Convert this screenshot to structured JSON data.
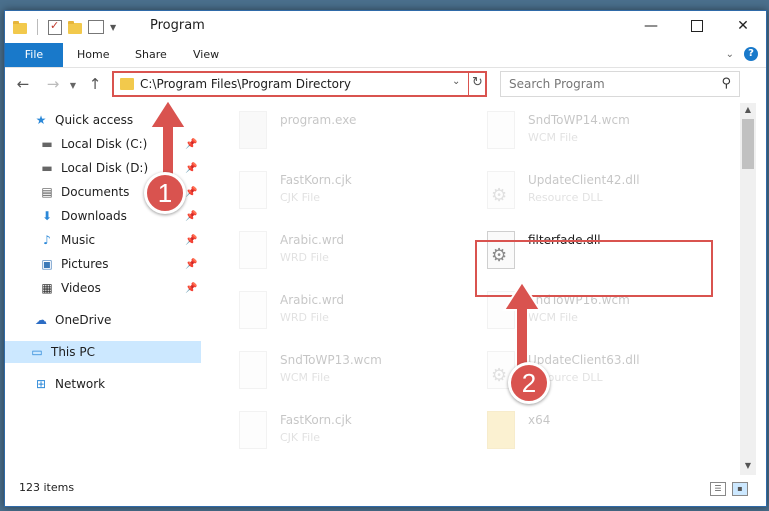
{
  "window": {
    "title": "Program"
  },
  "ribbon": {
    "tabs": [
      "File",
      "Home",
      "Share",
      "View"
    ]
  },
  "navigation": {
    "address": "C:\\Program Files\\Program Directory",
    "search_placeholder": "Search Program"
  },
  "sidebar": {
    "items": [
      {
        "label": "Quick access",
        "icon": "star-icon"
      },
      {
        "label": "Local Disk (C:)",
        "icon": "drive-icon",
        "pinned": true
      },
      {
        "label": "Local Disk (D:)",
        "icon": "drive-icon",
        "pinned": true
      },
      {
        "label": "Documents",
        "icon": "documents-icon",
        "pinned": true
      },
      {
        "label": "Downloads",
        "icon": "download-icon",
        "pinned": true
      },
      {
        "label": "Music",
        "icon": "music-icon",
        "pinned": true
      },
      {
        "label": "Pictures",
        "icon": "pictures-icon",
        "pinned": true
      },
      {
        "label": "Videos",
        "icon": "videos-icon",
        "pinned": true
      },
      {
        "label": "OneDrive",
        "icon": "cloud-icon"
      },
      {
        "label": "This PC",
        "icon": "computer-icon",
        "selected": true
      },
      {
        "label": "Network",
        "icon": "network-icon"
      }
    ]
  },
  "files": {
    "left": [
      {
        "name": "program.exe",
        "type": ""
      },
      {
        "name": "FastKorn.cjk",
        "type": "CJK File"
      },
      {
        "name": "Arabic.wrd",
        "type": "WRD File"
      },
      {
        "name": "Arabic.wrd",
        "type": "WRD File"
      },
      {
        "name": "SndToWP13.wcm",
        "type": "WCM File"
      },
      {
        "name": "FastKorn.cjk",
        "type": "CJK File"
      }
    ],
    "right": [
      {
        "name": "SndToWP14.wcm",
        "type": "WCM File"
      },
      {
        "name": "UpdateClient42.dll",
        "type": "Resource DLL"
      },
      {
        "name": "filterfade.dll",
        "type": ""
      },
      {
        "name": "SndToWP16.wcm",
        "type": "WCM File"
      },
      {
        "name": "UpdateClient63.dll",
        "type": "Resource DLL"
      },
      {
        "name": "x64",
        "type": ""
      }
    ]
  },
  "status": {
    "items_count": "123 items"
  },
  "annotations": {
    "badge1": "1",
    "badge2": "2"
  },
  "colors": {
    "accent": "#1979ca",
    "highlight": "#d9534f"
  }
}
